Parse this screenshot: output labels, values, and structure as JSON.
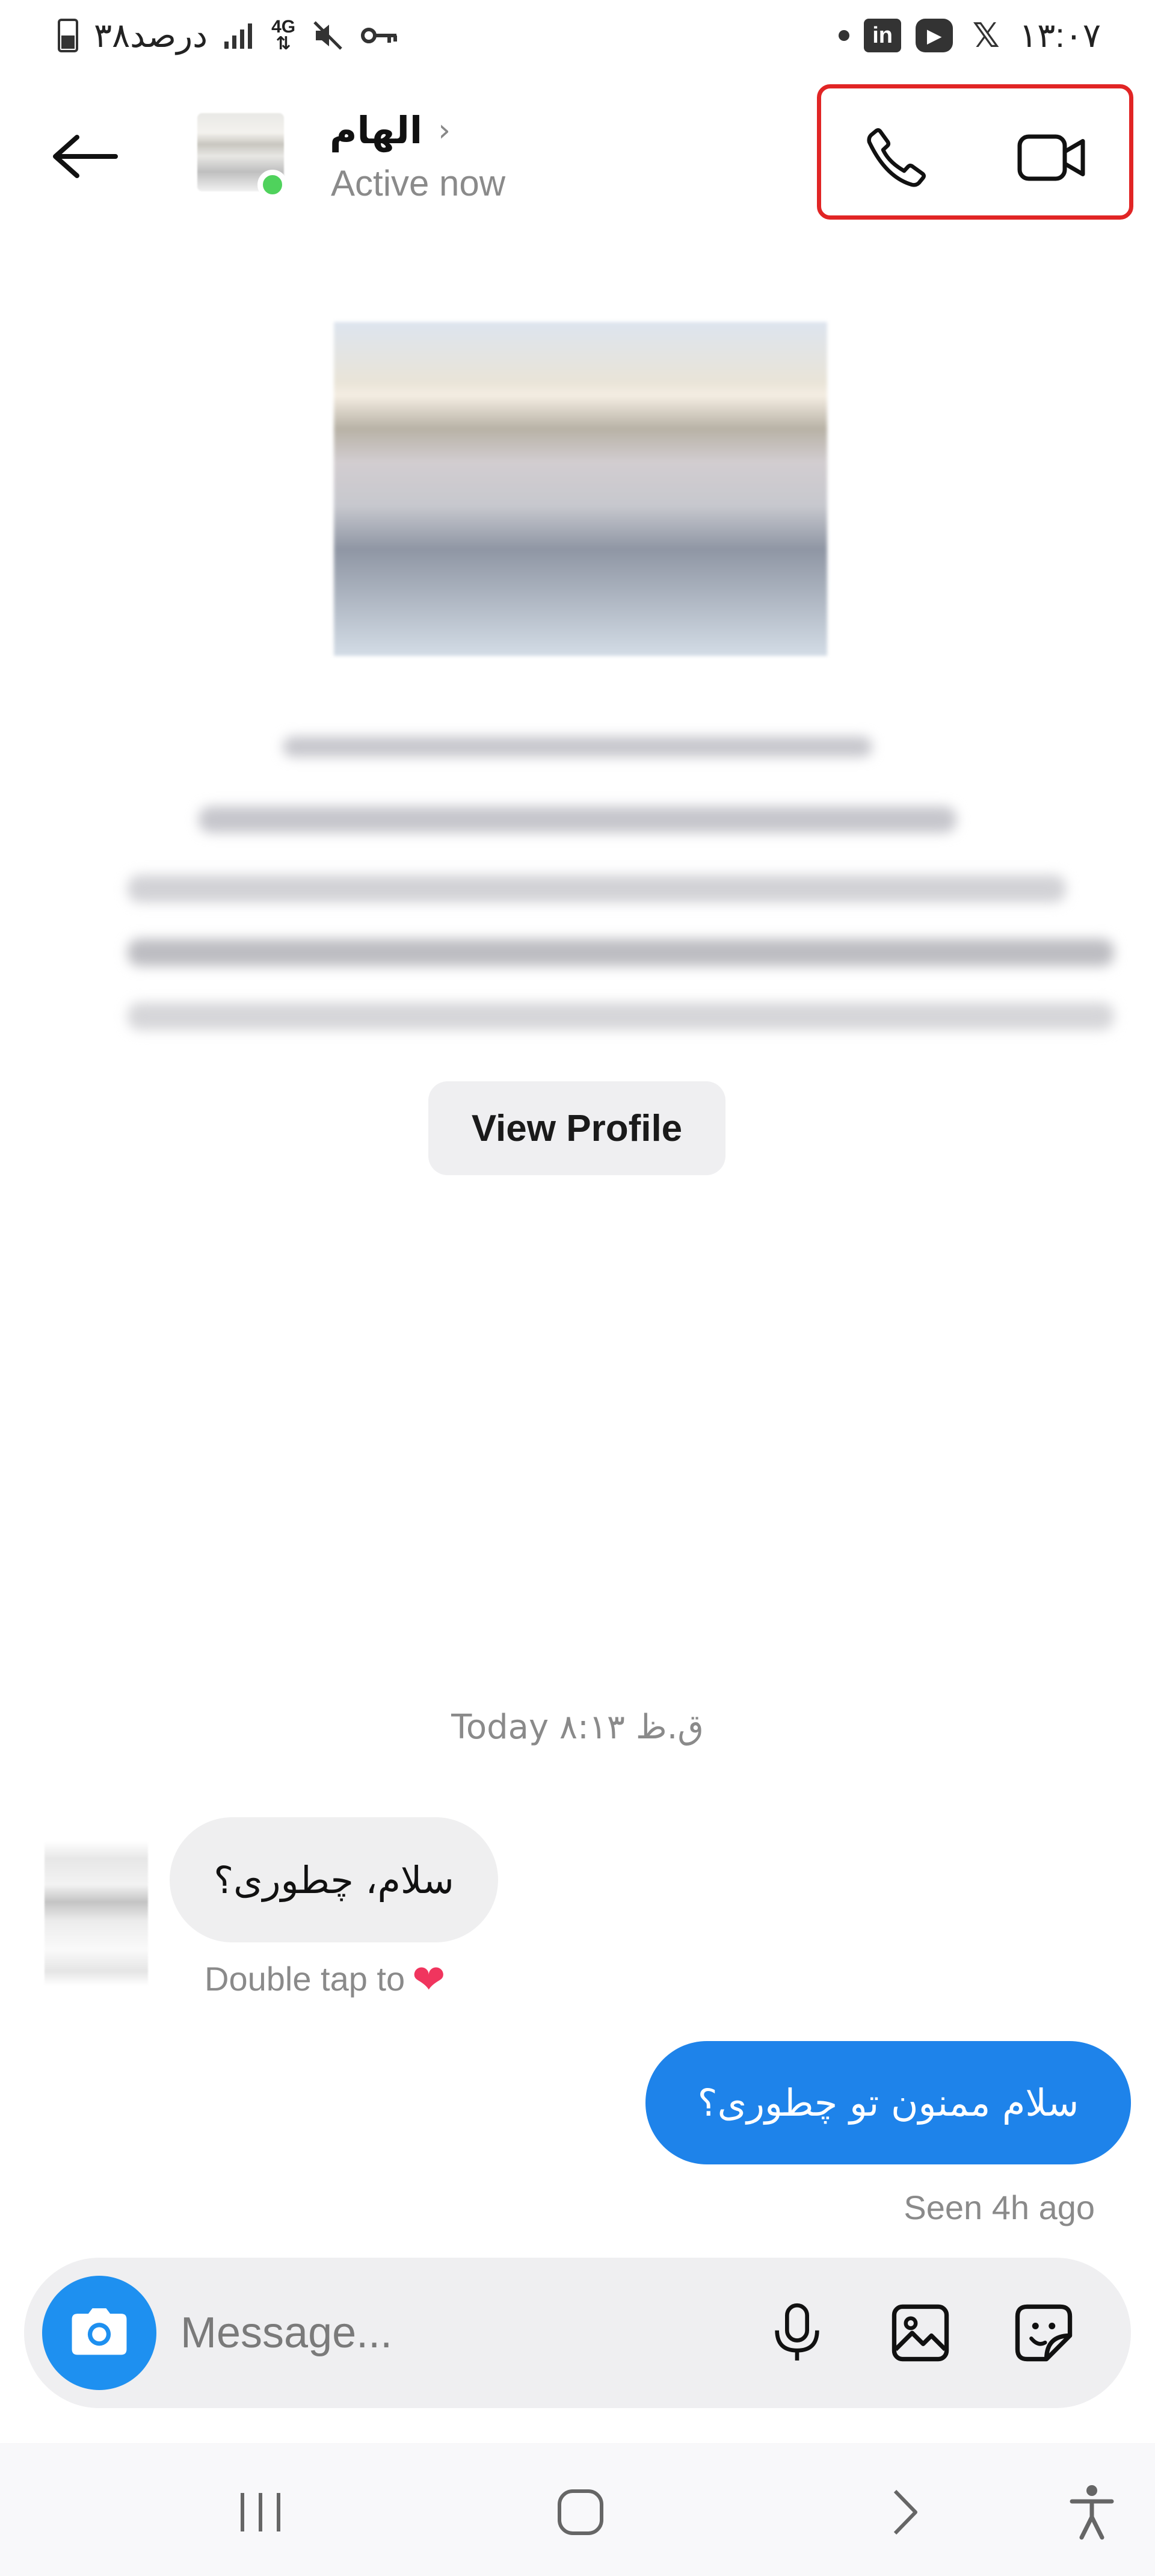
{
  "status_bar": {
    "time": "۱۳:۰۷",
    "battery_text": "۳۸درصد",
    "network_label": "4G",
    "apps": [
      "in",
      "▶",
      "𝕏"
    ],
    "icons": [
      "battery-icon",
      "signal-icon",
      "network-4g-icon",
      "mute-icon",
      "key-icon",
      "dot-icon",
      "linkedin-icon",
      "youtube-icon",
      "x-icon"
    ]
  },
  "header": {
    "contact_name": "الهام",
    "status": "Active now",
    "chevron": "›"
  },
  "profile": {
    "view_profile_label": "View Profile"
  },
  "conversation": {
    "timestamp": "Today ۸:۱۳ ق.ظ",
    "incoming": {
      "text": "سلام، چطوری؟",
      "hint": "Double tap to",
      "hint_emoji": "❤"
    },
    "outgoing": {
      "text": "سلام ممنون تو چطوری؟",
      "status": "Seen 4h ago"
    }
  },
  "composer": {
    "placeholder": "Message..."
  },
  "colors": {
    "accent": "#1e83ea",
    "camera": "#1e90f0",
    "online": "#4fd25c",
    "highlight_box": "#e12525",
    "heart": "#f0355e"
  }
}
